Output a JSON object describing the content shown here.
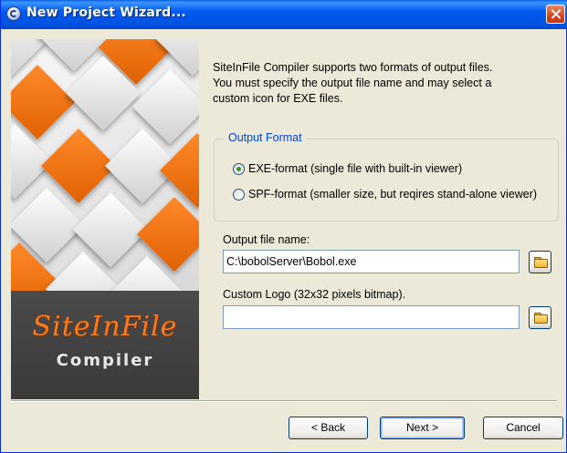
{
  "window": {
    "title": "New Project Wizard...",
    "icons": {
      "app": "app-icon",
      "close": "close-icon"
    }
  },
  "banner": {
    "logo_text": "SiteInFile",
    "subtitle": "Compiler",
    "colors": {
      "accent": "#ff7a1a",
      "dark": "#3f3f3f"
    }
  },
  "description": {
    "line1": "SiteInFile Compiler supports two formats of output files.",
    "line2": "You must specify the output file name and may select a",
    "line3": "custom icon for EXE files."
  },
  "output_format": {
    "legend": "Output Format",
    "options": [
      {
        "label": "EXE-format (single file with built-in viewer)",
        "selected": true
      },
      {
        "label": "SPF-format (smaller size, but reqires stand-alone viewer)",
        "selected": false
      }
    ]
  },
  "output_file": {
    "label": "Output file name:",
    "value": "C:\\bobolServer\\Bobol.exe",
    "browse_icon": "folder-icon"
  },
  "custom_logo": {
    "label": "Custom Logo (32x32 pixels bitmap).",
    "value": "",
    "browse_icon": "folder-icon"
  },
  "buttons": {
    "back": "< Back",
    "next": "Next >",
    "cancel": "Cancel"
  },
  "colors": {
    "titlebar": "#0054e3",
    "group_legend": "#0046d5",
    "radio_checked": "#21a121",
    "window_bg": "#ece9d8"
  }
}
